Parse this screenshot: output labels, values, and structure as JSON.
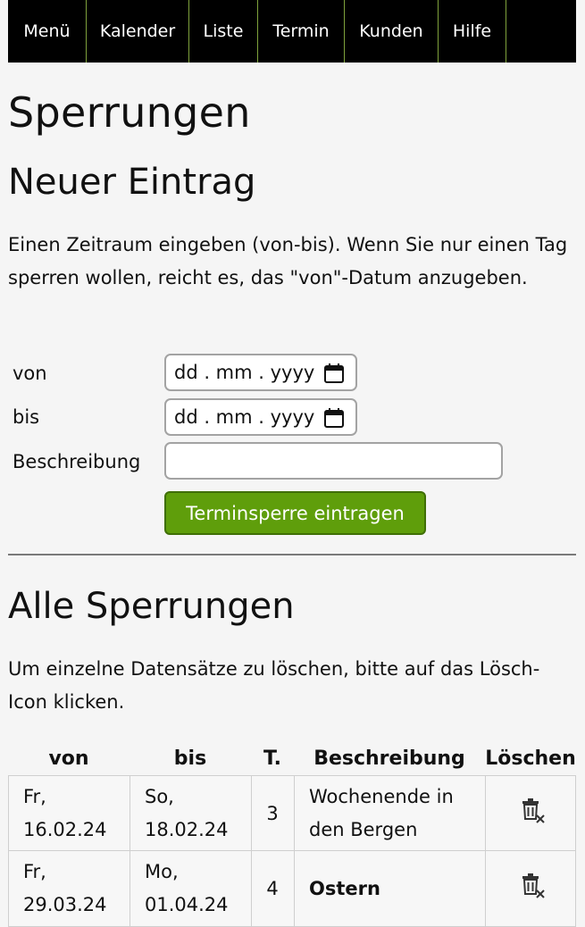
{
  "nav": {
    "items": [
      "Menü",
      "Kalender",
      "Liste",
      "Termin",
      "Kunden",
      "Hilfe"
    ]
  },
  "page": {
    "title": "Sperrungen",
    "new_entry_heading": "Neuer Eintrag",
    "intro_text": "Einen Zeitraum eingeben (von-bis). Wenn Sie nur einen Tag sperren wollen, reicht es, das \"von\"-Datum anzugeben."
  },
  "form": {
    "from_label": "von",
    "to_label": "bis",
    "description_label": "Beschreibung",
    "date_placeholder": "dd . mm . yyyy",
    "description_value": "",
    "submit_label": "Terminsperre eintragen"
  },
  "list": {
    "heading": "Alle Sperrungen",
    "hint": "Um einzelne Datensätze zu löschen, bitte auf das Lösch-Icon klicken.",
    "columns": [
      "von",
      "bis",
      "T.",
      "Beschreibung",
      "Löschen"
    ],
    "rows": [
      {
        "from_day": "Fr,",
        "from_date": "16.02.24",
        "to_day": "So,",
        "to_date": "18.02.24",
        "days": "3",
        "desc_line1": "Wochenende in",
        "desc_line2": "den Bergen",
        "desc_bold": false
      },
      {
        "from_day": "Fr,",
        "from_date": "29.03.24",
        "to_day": "Mo,",
        "to_date": "01.04.24",
        "days": "4",
        "desc_line1": "Ostern",
        "desc_line2": "",
        "desc_bold": true
      }
    ]
  },
  "icons": {
    "calendar": "calendar-icon",
    "delete": "trash-delete-icon"
  },
  "colors": {
    "nav_bg": "#000000",
    "nav_divider": "#7fa23c",
    "button_bg": "#5f9e0b",
    "page_bg": "#f5f5f5"
  }
}
